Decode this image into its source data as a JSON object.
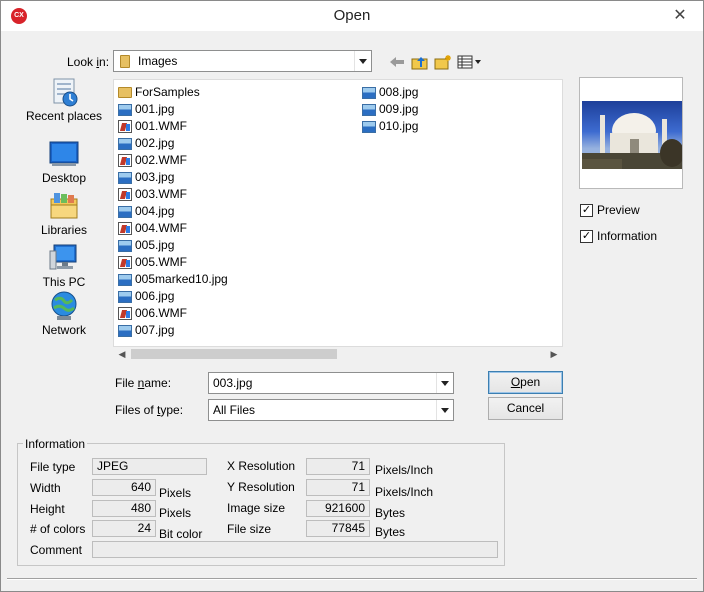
{
  "window": {
    "title": "Open",
    "app_icon_text": "CX",
    "close_glyph": "✕"
  },
  "lookin": {
    "label_pre": "Look ",
    "label_ul": "i",
    "label_post": "n:",
    "value": "Images"
  },
  "toolbar": {
    "icons": [
      "back-arrow-icon",
      "up-folder-icon",
      "new-folder-icon",
      "view-menu-icon"
    ]
  },
  "places": [
    {
      "label": "Recent places",
      "icon": "recent-places-icon"
    },
    {
      "label": "Desktop",
      "icon": "desktop-icon"
    },
    {
      "label": "Libraries",
      "icon": "libraries-icon"
    },
    {
      "label": "This PC",
      "icon": "this-pc-icon"
    },
    {
      "label": "Network",
      "icon": "network-icon"
    }
  ],
  "files": {
    "col1": [
      {
        "name": "ForSamples",
        "type": "folder"
      },
      {
        "name": "001.jpg",
        "type": "jpg"
      },
      {
        "name": "001.WMF",
        "type": "wmf"
      },
      {
        "name": "002.jpg",
        "type": "jpg"
      },
      {
        "name": "002.WMF",
        "type": "wmf"
      },
      {
        "name": "003.jpg",
        "type": "jpg"
      },
      {
        "name": "003.WMF",
        "type": "wmf"
      },
      {
        "name": "004.jpg",
        "type": "jpg"
      },
      {
        "name": "004.WMF",
        "type": "wmf"
      },
      {
        "name": "005.jpg",
        "type": "jpg"
      },
      {
        "name": "005.WMF",
        "type": "wmf"
      },
      {
        "name": "005marked10.jpg",
        "type": "jpg"
      },
      {
        "name": "006.jpg",
        "type": "jpg"
      },
      {
        "name": "006.WMF",
        "type": "wmf"
      },
      {
        "name": "007.jpg",
        "type": "jpg"
      }
    ],
    "col2": [
      {
        "name": "008.jpg",
        "type": "jpg"
      },
      {
        "name": "009.jpg",
        "type": "jpg"
      },
      {
        "name": "010.jpg",
        "type": "jpg"
      }
    ]
  },
  "preview": {
    "checkbox_label": "Preview",
    "checked": true
  },
  "information_toggle": {
    "checkbox_label": "Information",
    "checked": true
  },
  "filename": {
    "label_pre": "File ",
    "label_ul": "n",
    "label_post": "ame:",
    "value": "003.jpg"
  },
  "filetype": {
    "label_pre": "Files of ",
    "label_ul": "t",
    "label_post": "ype:",
    "value": "All Files"
  },
  "buttons": {
    "open": {
      "label_ul": "O",
      "label_post": "pen"
    },
    "cancel": {
      "label": "Cancel"
    }
  },
  "info": {
    "group_label": "Information",
    "file_type_label": "File type",
    "file_type": "JPEG",
    "width_label": "Width",
    "width": "640",
    "width_unit": "Pixels",
    "height_label": "Height",
    "height": "480",
    "height_unit": "Pixels",
    "colors_label": "# of colors",
    "colors": "24",
    "colors_unit": "Bit color",
    "comment_label": "Comment",
    "comment": "",
    "xres_label": "X Resolution",
    "xres": "71",
    "xres_unit": "Pixels/Inch",
    "yres_label": "Y Resolution",
    "yres": "71",
    "yres_unit": "Pixels/Inch",
    "image_size_label": "Image size",
    "image_size": "921600",
    "image_size_unit": "Bytes",
    "file_size_label": "File size",
    "file_size": "77845",
    "file_size_unit": "Bytes"
  }
}
